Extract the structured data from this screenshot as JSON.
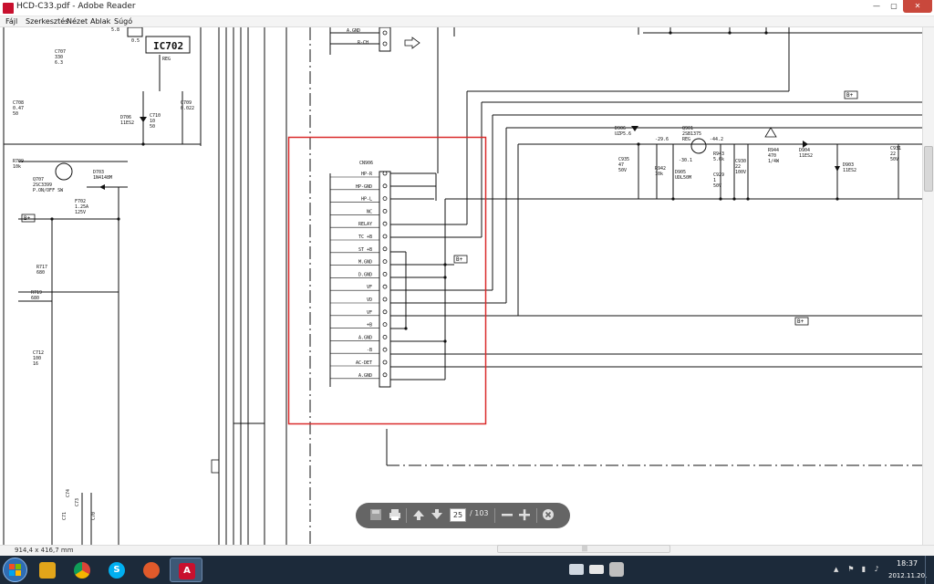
{
  "window": {
    "title": "HCD-C33.pdf - Adobe Reader",
    "controls": {
      "minimize": "—",
      "maximize": "▢",
      "close": "✕"
    }
  },
  "menu": [
    "Fájl",
    "Szerkesztés",
    "Nézet",
    "Ablak",
    "Súgó"
  ],
  "schematic": {
    "connector_title": "CN906",
    "connector_pins": [
      "HP-R",
      "HP-GND",
      "HP-L",
      "NC",
      "RELAY",
      "TC +B",
      "ST +B",
      "M.GND",
      "D.GND",
      "VF",
      "VD",
      "VF",
      "+B",
      "A.GND",
      "-B",
      "AC-DET",
      "A.GND"
    ],
    "ic_label": "IC702",
    "ic_sub": "REG",
    "top_pins": [
      "A.GND",
      "R-CH"
    ],
    "components": [
      {
        "ref": "C707",
        "val": "330",
        "val2": "6.3"
      },
      {
        "ref": "C708",
        "val": "0.47",
        "val2": "50"
      },
      {
        "ref": "R709",
        "val": "10k"
      },
      {
        "ref": "Q707",
        "val": "2SC3399",
        "val2": "P.ON/OFF SW"
      },
      {
        "ref": "D703",
        "val": "1N4148M"
      },
      {
        "ref": "F702",
        "val": "1.25A",
        "val2": "125V"
      },
      {
        "ref": "R717",
        "val": "680"
      },
      {
        "ref": "R719",
        "val": "680"
      },
      {
        "ref": "C712",
        "val": "100",
        "val2": "16"
      },
      {
        "ref": "D706",
        "val": "11ES2"
      },
      {
        "ref": "C710",
        "val": "10",
        "val2": "50"
      },
      {
        "ref": "C709",
        "val": "0.022"
      },
      {
        "ref": "D906",
        "val": "UZP5.6"
      },
      {
        "ref": "Q901",
        "val": "2SB1375",
        "val2": "REG"
      },
      {
        "ref": "C935",
        "val": "47",
        "val2": "50V"
      },
      {
        "ref": "R942",
        "val": "10k"
      },
      {
        "ref": "D905",
        "val": "UDL50M"
      },
      {
        "ref": "R943",
        "val": "5.6k"
      },
      {
        "ref": "C929",
        "val": "1",
        "val2": "50V"
      },
      {
        "ref": "C930",
        "val": "22",
        "val2": "100V"
      },
      {
        "ref": "R944",
        "val": "470",
        "val2": "1/4W"
      },
      {
        "ref": "D904",
        "val": "11ES2"
      },
      {
        "ref": "D903",
        "val": "11ES2"
      },
      {
        "ref": "C931",
        "val": "22",
        "val2": "50V"
      }
    ],
    "voltages": [
      "-29.6",
      "-44.2",
      "-30.1",
      "5.8",
      "0.5"
    ],
    "badge": "B+",
    "misc_refs": [
      "C74",
      "C73",
      "C71",
      "C70"
    ]
  },
  "status": {
    "page_size": "914,4 x 416,7 mm"
  },
  "floating_toolbar": {
    "current_page": "25",
    "total": "/ 103",
    "buttons": [
      "save-icon",
      "print-icon",
      "prev-page-icon",
      "next-page-icon",
      "zoom-out-icon",
      "zoom-in-icon",
      "close-icon"
    ]
  },
  "taskbar": {
    "apps": [
      "windows-explorer",
      "chrome",
      "skype",
      "maps",
      "adobe-reader"
    ],
    "tray_flag": "▲",
    "time": "18:37",
    "date": "2012.11.20."
  },
  "colors": {
    "highlight_box": "#d92b2b",
    "taskbar": "#1c2a3a",
    "chrome": "#e2a51a",
    "skype": "#00aff0",
    "maps": "#e05a2b",
    "adobe": "#c8102e"
  }
}
